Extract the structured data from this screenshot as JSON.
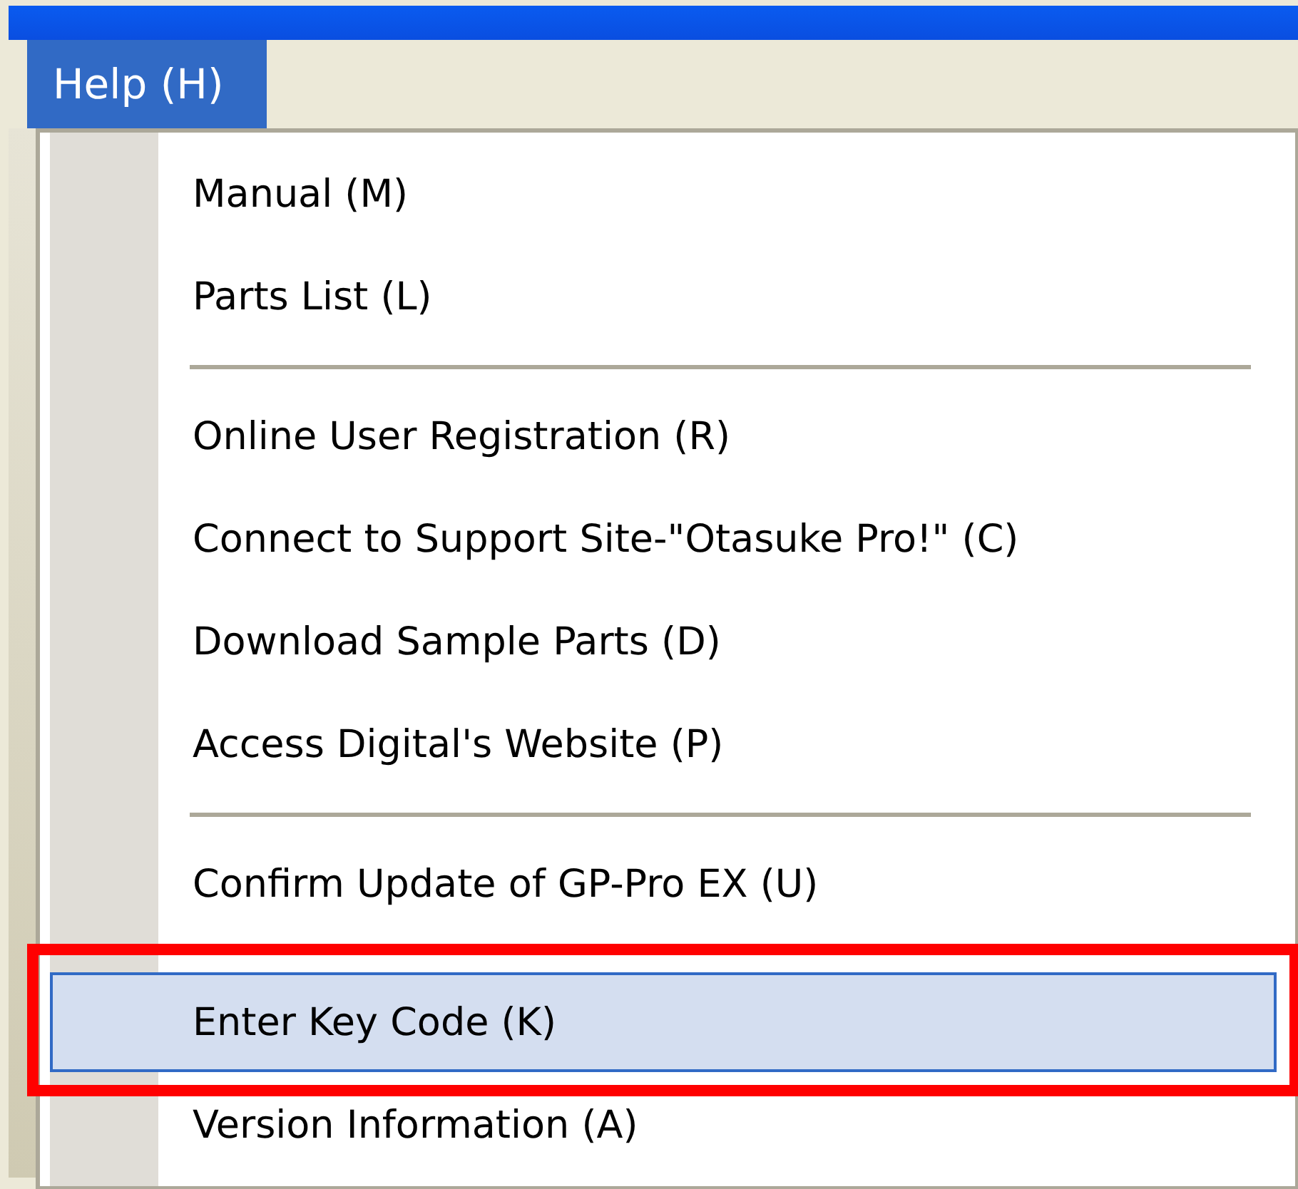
{
  "menu_bar": {
    "items": [
      {
        "label": "Help (H)",
        "selected": true
      }
    ]
  },
  "menu": {
    "items": [
      {
        "kind": "item",
        "label": "Manual (M)",
        "selected": false,
        "callout": false
      },
      {
        "kind": "item",
        "label": "Parts List (L)",
        "selected": false,
        "callout": false
      },
      {
        "kind": "separator"
      },
      {
        "kind": "item",
        "label": "Online User Registration (R)",
        "selected": false,
        "callout": false
      },
      {
        "kind": "item",
        "label": "Connect to Support Site-\"Otasuke Pro!\" (C)",
        "selected": false,
        "callout": false
      },
      {
        "kind": "item",
        "label": "Download Sample Parts (D)",
        "selected": false,
        "callout": false
      },
      {
        "kind": "item",
        "label": "Access Digital's Website (P)",
        "selected": false,
        "callout": false
      },
      {
        "kind": "separator"
      },
      {
        "kind": "item",
        "label": "Confirm Update of GP-Pro EX (U)",
        "selected": false,
        "callout": false
      },
      {
        "kind": "item",
        "label": "Enter Key Code (K)",
        "selected": true,
        "callout": true
      },
      {
        "kind": "item",
        "label": "Version Information (A)",
        "selected": false,
        "callout": false
      }
    ]
  }
}
